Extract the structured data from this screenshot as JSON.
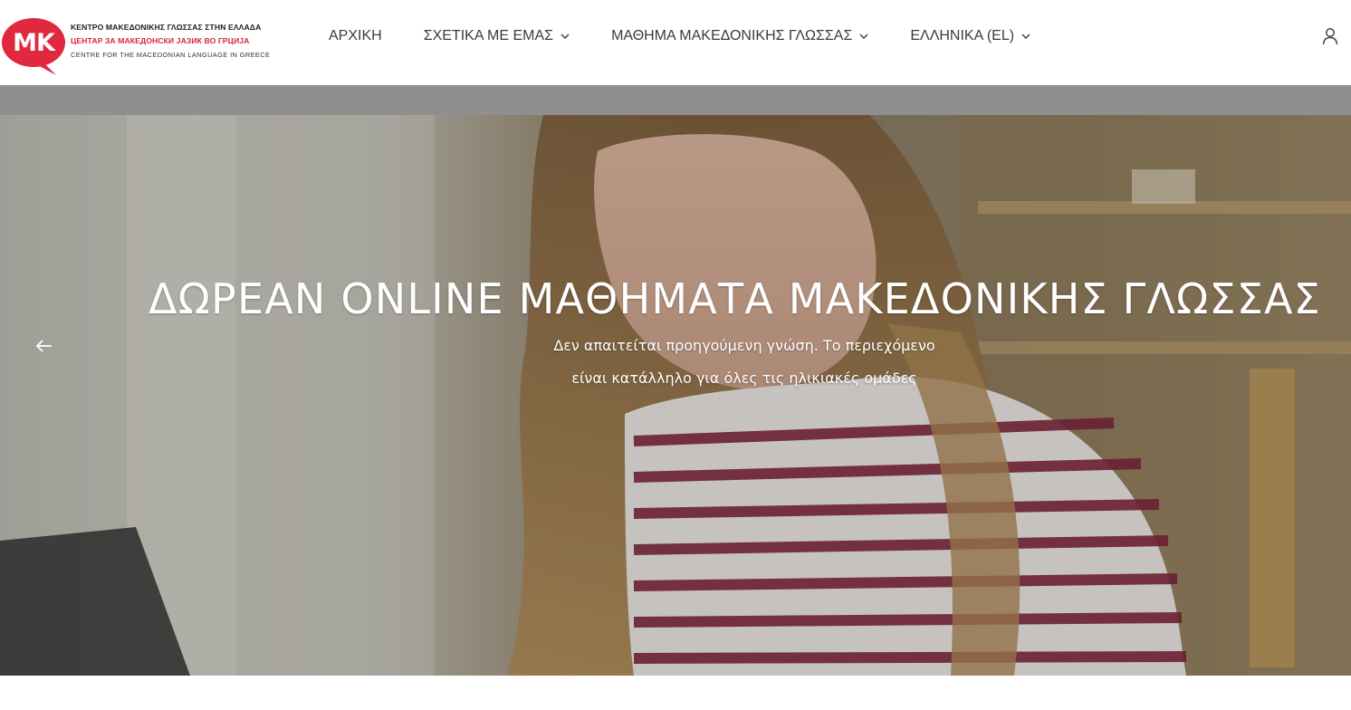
{
  "logo": {
    "badge_text": "MK",
    "line1": "ΚΕΝΤΡΟ ΜΑΚΕΔΟΝΙΚΗΣ ΓΛΩΣΣΑΣ ΣΤΗΝ ΕΛΛΑΔΑ",
    "line2": "ЦЕНТАР ЗА МАКЕДОНСКИ ЈАЗИК ВО ГРЦИЈА",
    "line3": "CENTRE FOR THE MACEDONIAN LANGUAGE IN GREECE",
    "badge_color": "#e0283f"
  },
  "nav": {
    "items": [
      {
        "label": "ΑΡΧΙΚΗ",
        "has_dropdown": false
      },
      {
        "label": "ΣΧΕΤΙΚΑ ΜΕ ΕΜΑΣ",
        "has_dropdown": true
      },
      {
        "label": "ΜΑΘΗΜΑ ΜΑΚΕΔΟΝΙΚΗΣ ΓΛΩΣΣΑΣ",
        "has_dropdown": true
      },
      {
        "label": "ΕΛΛΗΝΙΚΑ (EL)",
        "has_dropdown": true
      }
    ],
    "user_icon": "user-icon"
  },
  "hero": {
    "title": "ΔΩΡΕΑΝ ONLINE ΜΑΘΗΜΑΤΑ ΜΑΚΕΔΟΝΙΚΗΣ ΓΛΩΣΣΑΣ",
    "subtitle_line1": "Δεν απαιτείται προηγούμενη γνώση. Το περιεχόμενο",
    "subtitle_line2": "είναι κατάλληλο για όλες τις ηλικιακές ομάδες",
    "prev_icon": "arrow-left-icon"
  }
}
